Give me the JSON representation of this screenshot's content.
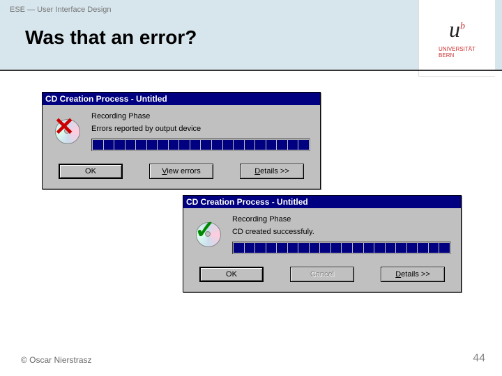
{
  "header": {
    "course_tag": "ESE — User Interface Design",
    "title": "Was that an error?",
    "logo": {
      "label_line1": "UNIVERSITÄT",
      "label_line2": "BERN"
    }
  },
  "dialog1": {
    "title": "CD Creation Process - Untitled",
    "phase": "Recording Phase",
    "status": "Errors reported by output device",
    "icon_mark": "✕",
    "buttons": {
      "ok": "OK",
      "view_errors": "View errors",
      "details": "Details >>"
    }
  },
  "dialog2": {
    "title": "CD Creation Process - Untitled",
    "phase": "Recording Phase",
    "status": "CD created successfuly.",
    "icon_mark": "✓",
    "buttons": {
      "ok": "OK",
      "cancel": "Cancel",
      "details": "Details >>"
    }
  },
  "footer": {
    "copyright": "© Oscar Nierstrasz",
    "page_number": "44"
  }
}
